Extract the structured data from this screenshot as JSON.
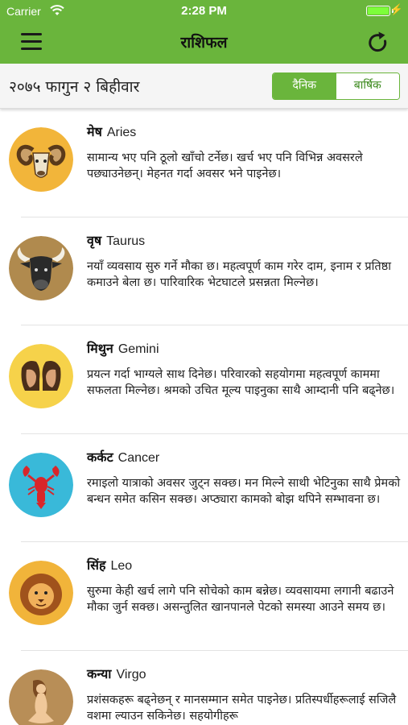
{
  "status_bar": {
    "carrier": "Carrier",
    "time": "2:28 PM"
  },
  "nav": {
    "title": "राशिफल"
  },
  "date_bar": {
    "date": "२०७५ फागुन २ बिहीवार",
    "tab_daily": "दैनिक",
    "tab_yearly": "बार्षिक"
  },
  "colors": {
    "brand_green": "#6ab53c",
    "icon_bg": [
      "#f2b53a",
      "#b08a4e",
      "#f6d24a",
      "#39b9d9",
      "#f1b43a",
      "#b88e57"
    ]
  },
  "signs": [
    {
      "nepali": "मेष",
      "english": "Aries",
      "icon": "ram-icon",
      "text": "सामान्य भए पनि ठूलो खाँचो टर्नेछ। खर्च भए पनि विभिन्न अवसरले पछ्याउनेछन्। मेहनत गर्दा अवसर भने पाइनेछ।"
    },
    {
      "nepali": "वृष",
      "english": "Taurus",
      "icon": "bull-icon",
      "text": "नयाँ व्यवसाय सुरु गर्ने मौका छ। महत्वपूर्ण काम गरेर दाम, इनाम र प्रतिष्ठा कमाउने बेला छ। पारिवारिक भेटघाटले प्रसन्नता मिल्नेछ।"
    },
    {
      "nepali": "मिथुन",
      "english": "Gemini",
      "icon": "twins-icon",
      "text": "प्रयत्न गर्दा भाग्यले साथ दिनेछ। परिवारको सहयोगमा महत्वपूर्ण काममा सफलता मिल्नेछ। श्रमको उचित मूल्य पाइनुका साथै आम्दानी पनि बढ्नेछ।"
    },
    {
      "nepali": "कर्कट",
      "english": "Cancer",
      "icon": "lobster-icon",
      "text": "रमाइलो यात्राको अवसर जुट्न सक्छ। मन मिल्ने साथी भेटिनुका साथै प्रेमको बन्धन समेत कसिन सक्छ। अप्ठ्यारा कामको बोझ थपिने सम्भावना छ।"
    },
    {
      "nepali": "सिंह",
      "english": "Leo",
      "icon": "lion-icon",
      "text": "सुरुमा केही खर्च लागे पनि सोचेको काम बन्नेछ। व्यवसायमा लगानी बढाउने मौका जुर्न सक्छ। असन्तुलित खानपानले पेटको समस्या आउने समय छ।"
    },
    {
      "nepali": "कन्या",
      "english": "Virgo",
      "icon": "maiden-icon",
      "text": "प्रशंसकहरू बढ्नेछन् र मानसम्मान समेत पाइनेछ। प्रतिस्पर्धीहरूलाई सजिलै वशमा ल्याउन सकिनेछ। सहयोगीहरू"
    }
  ]
}
